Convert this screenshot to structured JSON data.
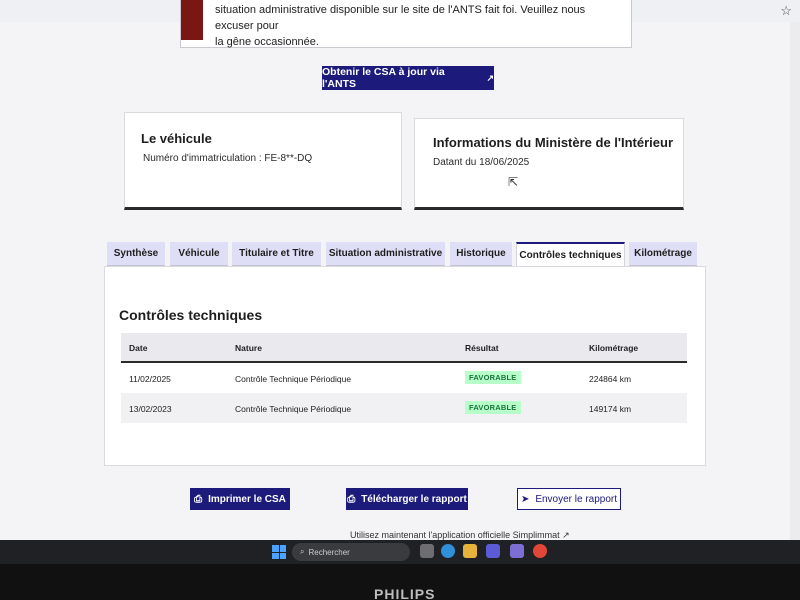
{
  "alert": {
    "text_line1": "situation administrative disponible sur le site de l'ANTS fait foi. Veuillez nous excuser pour",
    "text_line2": "la gêne occasionnée."
  },
  "csa_button": {
    "label": "Obtenir le CSA à jour via l'ANTS",
    "icon": "external-link-icon"
  },
  "vehicule_card": {
    "title": "Le véhicule",
    "immatriculation": "Numéro d'immatriculation : FE-8**-DQ"
  },
  "ministere_card": {
    "title": "Informations du Ministère de l'Intérieur",
    "date": "Datant du 18/06/2025"
  },
  "tabs": [
    {
      "label": "Synthèse",
      "active": false
    },
    {
      "label": "Véhicule",
      "active": false
    },
    {
      "label": "Titulaire et Titre",
      "active": false
    },
    {
      "label": "Situation administrative",
      "active": false
    },
    {
      "label": "Historique",
      "active": false
    },
    {
      "label": "Contrôles techniques",
      "active": true
    },
    {
      "label": "Kilométrage",
      "active": false
    }
  ],
  "controles": {
    "title": "Contrôles techniques",
    "headers": {
      "date": "Date",
      "nature": "Nature",
      "resultat": "Résultat",
      "kilometrage": "Kilométrage"
    },
    "rows": [
      {
        "date": "11/02/2025",
        "nature": "Contrôle Technique Périodique",
        "resultat": "FAVORABLE",
        "kilometrage": "224864 km"
      },
      {
        "date": "13/02/2023",
        "nature": "Contrôle Technique Périodique",
        "resultat": "FAVORABLE",
        "kilometrage": "149174 km"
      }
    ]
  },
  "actions": {
    "print": "Imprimer le CSA",
    "download": "Télécharger le rapport",
    "send": "Envoyer le rapport"
  },
  "note": "Utilisez maintenant l'application officielle Simplimmat",
  "taskbar": {
    "search_placeholder": "Rechercher"
  },
  "monitor_brand": "PHILIPS",
  "colors": {
    "primary": "#1c1a7a",
    "alert_bar": "#7a1715",
    "badge_bg": "#b8fec9",
    "badge_text": "#18753c"
  }
}
